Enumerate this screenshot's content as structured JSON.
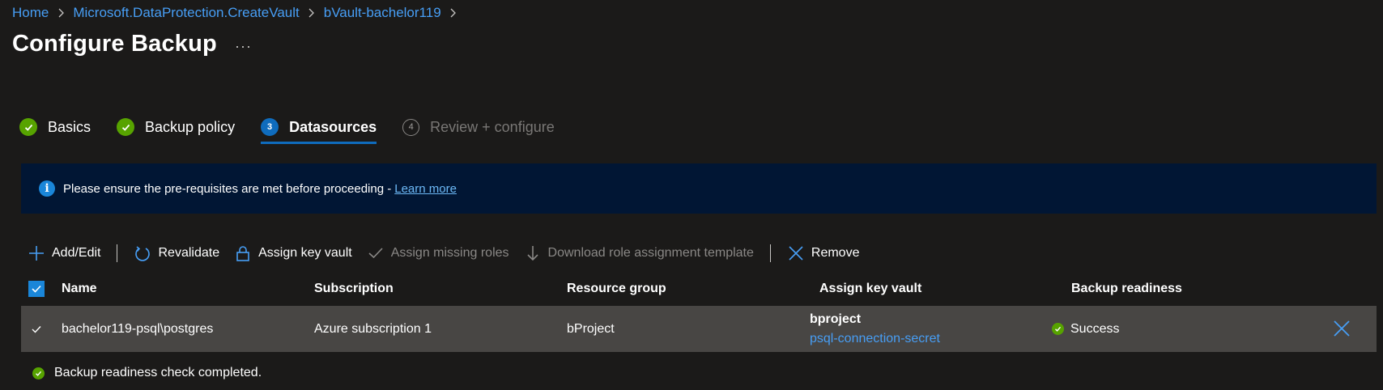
{
  "breadcrumb": {
    "items": [
      "Home",
      "Microsoft.DataProtection.CreateVault",
      "bVault-bachelor119"
    ]
  },
  "page": {
    "title": "Configure Backup",
    "more_label": "···"
  },
  "steps": [
    {
      "label": "Basics",
      "state": "done"
    },
    {
      "label": "Backup policy",
      "state": "done"
    },
    {
      "label": "Datasources",
      "state": "current",
      "number": "3"
    },
    {
      "label": "Review + configure",
      "state": "todo",
      "number": "4"
    }
  ],
  "banner": {
    "text": "Please ensure the pre-requisites are met before proceeding -",
    "link": "Learn more",
    "icon": "info-icon"
  },
  "toolbar": {
    "add_edit": "Add/Edit",
    "revalidate": "Revalidate",
    "assign_key_vault": "Assign key vault",
    "assign_missing_roles": "Assign missing roles",
    "download_template": "Download role assignment template",
    "remove": "Remove"
  },
  "table": {
    "headers": {
      "name": "Name",
      "subscription": "Subscription",
      "resource_group": "Resource group",
      "key_vault": "Assign key vault",
      "readiness": "Backup readiness"
    },
    "rows": [
      {
        "name": "bachelor119-psql\\postgres",
        "subscription": "Azure subscription 1",
        "resource_group": "bProject",
        "key_vault": "bproject",
        "secret": "psql-connection-secret",
        "readiness": "Success"
      }
    ]
  },
  "footer": {
    "status": "Backup readiness check completed."
  },
  "colors": {
    "accent": "#0f6cbd",
    "link": "#479ef5",
    "success": "#57a300",
    "banner_bg": "#011634",
    "row_bg": "#484644"
  }
}
